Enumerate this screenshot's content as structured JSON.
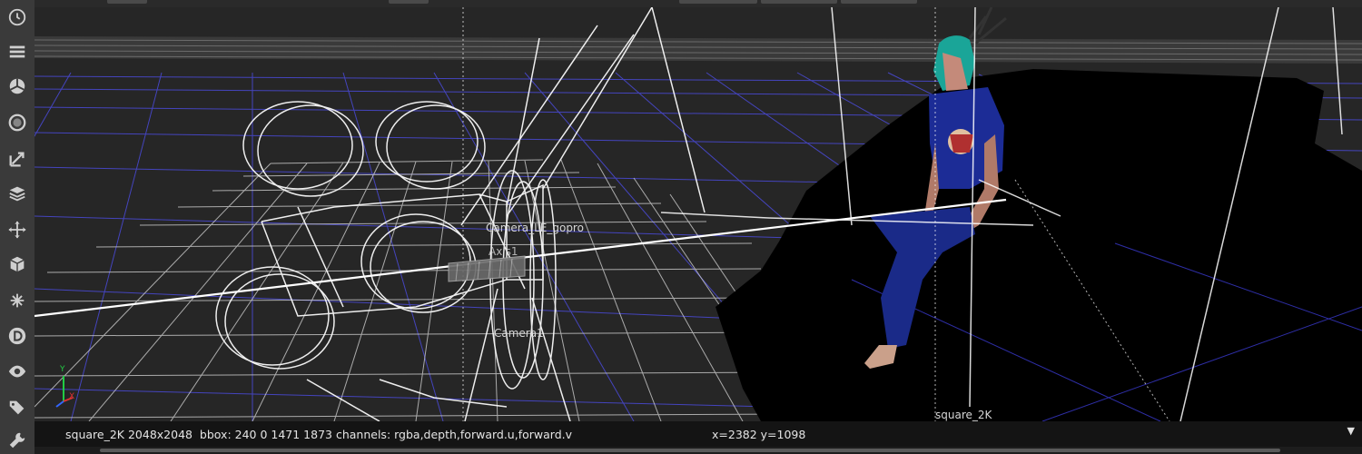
{
  "toolbar": {
    "tools": [
      {
        "name": "history-icon"
      },
      {
        "name": "list-icon"
      },
      {
        "name": "sphere-shading-icon"
      },
      {
        "name": "circle-icon"
      },
      {
        "name": "transform-arrow-icon"
      },
      {
        "name": "layers-icon"
      },
      {
        "name": "move-icon"
      },
      {
        "name": "cube-icon"
      },
      {
        "name": "particles-icon"
      },
      {
        "name": "d-icon"
      },
      {
        "name": "eye-icon"
      },
      {
        "name": "tags-icon"
      },
      {
        "name": "wrench-icon"
      }
    ]
  },
  "viewport": {
    "labels": {
      "camera_gopro": "Camera_LE_gopro",
      "axis": "Axis1",
      "camera1": "Camera1",
      "card": "square_2K"
    },
    "axis_gizmo": {
      "y": "Y",
      "x": "X"
    },
    "colors": {
      "background": "#262626",
      "ground_grid": "#4a4ad8",
      "card_grid": "#dcdcdc",
      "wireframe": "#ffffff",
      "person_shirt": "#1c2f9a",
      "person_hair": "#16b3a6"
    }
  },
  "infobar": {
    "text": "square_2K 2048x2048  bbox: 240 0 1471 1873 channels: rgba,depth,forward.u,forward.v",
    "coords": "x=2382 y=1098",
    "dropdown": "▼"
  }
}
